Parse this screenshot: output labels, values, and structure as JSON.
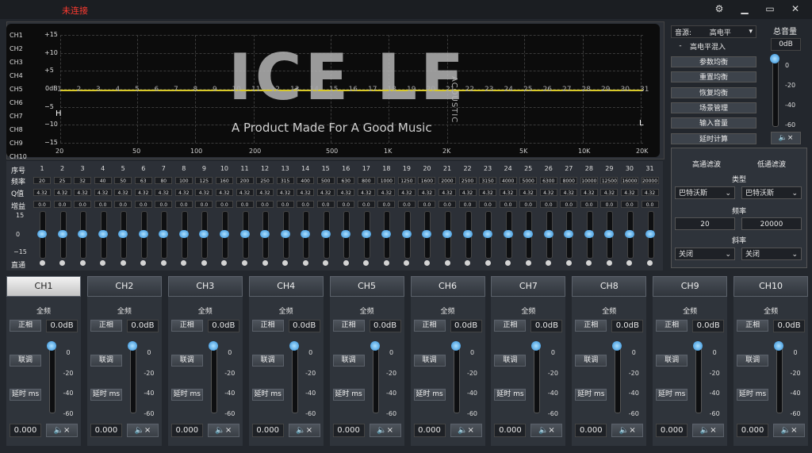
{
  "titlebar": {
    "status": "未连接",
    "icons": [
      "settings-wrench-icon",
      "minimize-icon",
      "maximize-icon",
      "close-icon"
    ]
  },
  "graph": {
    "channels": [
      "CH1",
      "CH2",
      "CH3",
      "CH4",
      "CH5",
      "CH6",
      "CH7",
      "CH8",
      "CH9",
      "CH10"
    ],
    "y_labels": [
      "+15",
      "+10",
      "+5",
      "0dB",
      "−5",
      "−10",
      "−15"
    ],
    "x_labels": [
      "20",
      "50",
      "100",
      "200",
      "500",
      "1K",
      "2K",
      "5K",
      "10K",
      "20K"
    ],
    "band_numbers": [
      "1",
      "2",
      "3",
      "4",
      "5",
      "6",
      "7",
      "8",
      "9",
      "10",
      "11",
      "12",
      "13",
      "14",
      "15",
      "16",
      "17",
      "18",
      "19",
      "20",
      "21",
      "22",
      "23",
      "24",
      "25",
      "26",
      "27",
      "28",
      "29",
      "30",
      "31"
    ],
    "logo": "ICE LE",
    "logo_side": "ACOUSTIC",
    "tagline": "A Product Made For A Good Music",
    "marker_h": "H",
    "marker_l": "L",
    "curve_color": "#d8c92a"
  },
  "eq": {
    "row_labels": {
      "index": "序号",
      "freq": "频率",
      "q": "Q值",
      "gain": "增益",
      "bypass": "直通"
    },
    "axis": {
      "top": "15",
      "mid": "0",
      "bottom": "−15"
    },
    "bands": [
      "1",
      "2",
      "3",
      "4",
      "5",
      "6",
      "7",
      "8",
      "9",
      "10",
      "11",
      "12",
      "13",
      "14",
      "15",
      "16",
      "17",
      "18",
      "19",
      "20",
      "21",
      "22",
      "23",
      "24",
      "25",
      "26",
      "27",
      "28",
      "29",
      "30",
      "31"
    ],
    "freqs": [
      "20",
      "25",
      "32",
      "40",
      "50",
      "63",
      "80",
      "100",
      "125",
      "160",
      "200",
      "250",
      "315",
      "400",
      "500",
      "630",
      "800",
      "1000",
      "1250",
      "1600",
      "2000",
      "2500",
      "3150",
      "4000",
      "5000",
      "6300",
      "8000",
      "10000",
      "12500",
      "16000",
      "20000"
    ],
    "q": "4.32",
    "gain": "0.0"
  },
  "source": {
    "label": "音源:",
    "value": "高电平",
    "mix_minus": "-",
    "mix_label": "高电平混入"
  },
  "right_buttons": [
    "参数均衡",
    "重置均衡",
    "恢复均衡",
    "场景管理",
    "输入音量",
    "延时计算"
  ],
  "master_volume": {
    "title": "总音量",
    "value": "0dB",
    "ticks": [
      "0",
      "-20",
      "-40",
      "-60"
    ],
    "mute_icon": "speaker-mute-icon"
  },
  "filter": {
    "hp_title": "高通滤波",
    "lp_title": "低通滤波",
    "type_label": "类型",
    "hp_type": "巴特沃斯",
    "lp_type": "巴特沃斯",
    "freq_label": "频率",
    "hp_freq": "20",
    "lp_freq": "20000",
    "slope_label": "斜率",
    "hp_slope": "关闭",
    "lp_slope": "关闭"
  },
  "strips": [
    {
      "name": "CH1",
      "full": "全频",
      "phase": "正相",
      "gain": "0.0dB",
      "link": "联调",
      "delay_label": "延时 ms",
      "delay": "0.000"
    },
    {
      "name": "CH2",
      "full": "全频",
      "phase": "正相",
      "gain": "0.0dB",
      "link": "联调",
      "delay_label": "延时 ms",
      "delay": "0.000"
    },
    {
      "name": "CH3",
      "full": "全频",
      "phase": "正相",
      "gain": "0.0dB",
      "link": "联调",
      "delay_label": "延时 ms",
      "delay": "0.000"
    },
    {
      "name": "CH4",
      "full": "全频",
      "phase": "正相",
      "gain": "0.0dB",
      "link": "联调",
      "delay_label": "延时 ms",
      "delay": "0.000"
    },
    {
      "name": "CH5",
      "full": "全频",
      "phase": "正相",
      "gain": "0.0dB",
      "link": "联调",
      "delay_label": "延时 ms",
      "delay": "0.000"
    },
    {
      "name": "CH6",
      "full": "全频",
      "phase": "正相",
      "gain": "0.0dB",
      "link": "联调",
      "delay_label": "延时 ms",
      "delay": "0.000"
    },
    {
      "name": "CH7",
      "full": "全频",
      "phase": "正相",
      "gain": "0.0dB",
      "link": "联调",
      "delay_label": "延时 ms",
      "delay": "0.000"
    },
    {
      "name": "CH8",
      "full": "全频",
      "phase": "正相",
      "gain": "0.0dB",
      "link": "联调",
      "delay_label": "延时 ms",
      "delay": "0.000"
    },
    {
      "name": "CH9",
      "full": "全频",
      "phase": "正相",
      "gain": "0.0dB",
      "link": "联调",
      "delay_label": "延时 ms",
      "delay": "0.000"
    },
    {
      "name": "CH10",
      "full": "全频",
      "phase": "正相",
      "gain": "0.0dB",
      "link": "联调",
      "delay_label": "延时 ms",
      "delay": "0.000"
    }
  ],
  "strip_ticks": [
    "0",
    "-20",
    "-40",
    "-60"
  ],
  "selected_strip": "CH1"
}
